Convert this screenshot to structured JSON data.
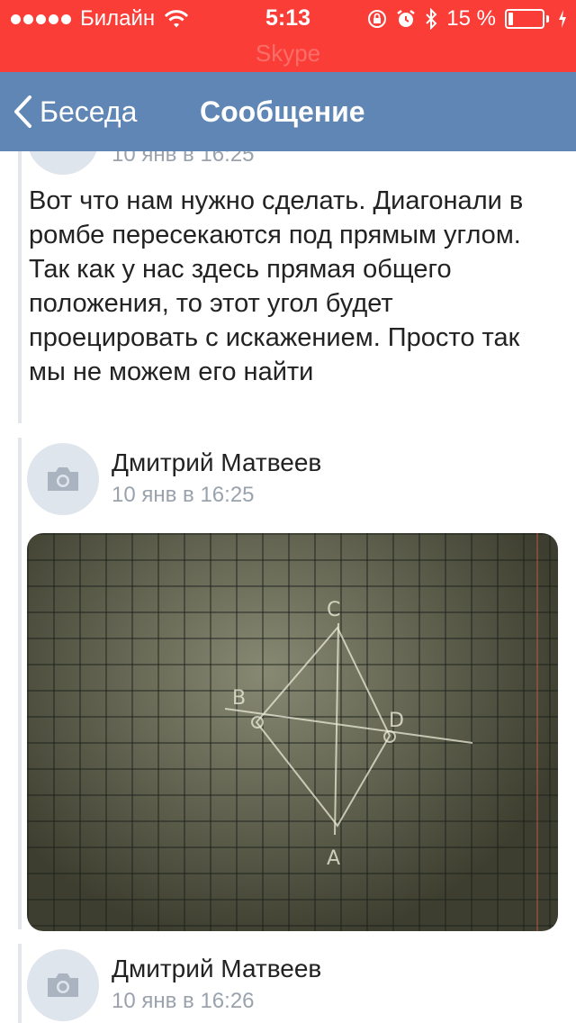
{
  "status_bar": {
    "carrier": "Билайн",
    "time": "5:13",
    "battery_text": "15 %",
    "battery_level": 0.15,
    "ghost_title": "Skype"
  },
  "nav": {
    "back_label": "Беседа",
    "title": "Сообщение"
  },
  "messages": [
    {
      "time": "10 янв в 16:25",
      "text": "Вот что нам нужно сделать. Диагонали в ромбе пересекаются под прямым углом. Так как у нас здесь прямая общего положения, то этот угол будет проецировать с искажением. Просто так мы не можем его найти"
    },
    {
      "author": "Дмитрий Матвеев",
      "time": "10 янв в 16:25",
      "photo_labels": [
        "С",
        "В",
        "D",
        "А"
      ]
    },
    {
      "author": "Дмитрий Матвеев",
      "time": "10 янв в 16:26"
    }
  ]
}
